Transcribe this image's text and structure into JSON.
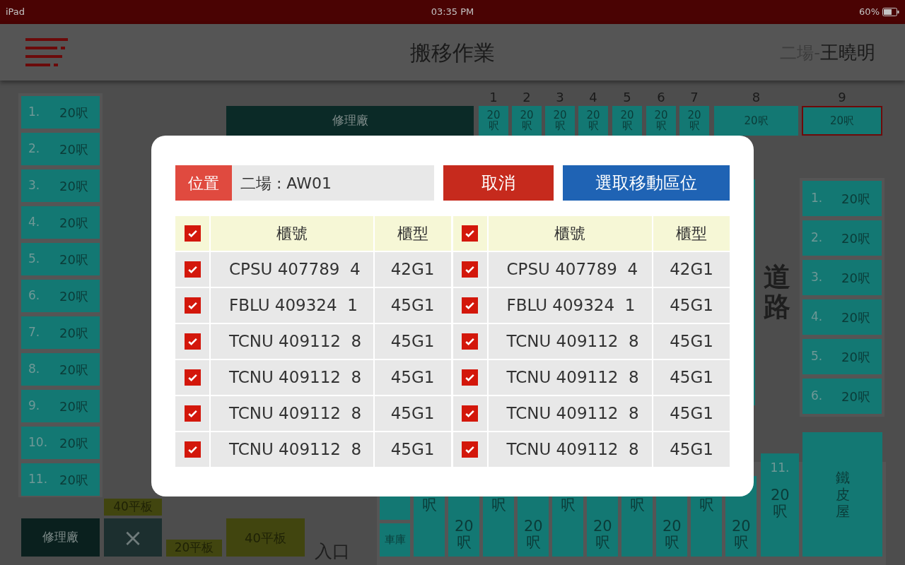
{
  "status_bar": {
    "device": "iPad",
    "time": "03:35 PM",
    "battery": "60%"
  },
  "header": {
    "title": "搬移作業",
    "site": "二場-",
    "user": "王曉明"
  },
  "top_area": {
    "workshop": "修理廠",
    "column_numbers": [
      "1",
      "2",
      "3",
      "4",
      "5",
      "6",
      "7",
      "8",
      "9"
    ],
    "slots": [
      {
        "label": "20呎",
        "kind": "narrow",
        "selected": false
      },
      {
        "label": "20呎",
        "kind": "narrow",
        "selected": false
      },
      {
        "label": "20呎",
        "kind": "narrow",
        "selected": false
      },
      {
        "label": "20呎",
        "kind": "narrow",
        "selected": false
      },
      {
        "label": "20呎",
        "kind": "narrow",
        "selected": false
      },
      {
        "label": "20呎",
        "kind": "narrow",
        "selected": false
      },
      {
        "label": "20呎",
        "kind": "narrow",
        "selected": false
      },
      {
        "label": "20呎",
        "kind": "wide",
        "selected": false
      },
      {
        "label": "20呎",
        "kind": "wide",
        "selected": true
      }
    ]
  },
  "left_slots": [
    {
      "number": "1.",
      "size": "20呎"
    },
    {
      "number": "2.",
      "size": "20呎"
    },
    {
      "number": "3.",
      "size": "20呎"
    },
    {
      "number": "4.",
      "size": "20呎"
    },
    {
      "number": "5.",
      "size": "20呎"
    },
    {
      "number": "6.",
      "size": "20呎"
    },
    {
      "number": "7.",
      "size": "20呎"
    },
    {
      "number": "8.",
      "size": "20呎"
    },
    {
      "number": "9.",
      "size": "20呎"
    },
    {
      "number": "10.",
      "size": "20呎"
    },
    {
      "number": "11.",
      "size": "20呎"
    }
  ],
  "bottom_left": {
    "flatbed_top": "40平板",
    "workshop": "修理廠",
    "closed_symbol": "×",
    "flatbed_small": "20平板",
    "flatbed_large": "40平板",
    "entrance": "入口"
  },
  "road": "道路",
  "right_slots": [
    {
      "number": "1.",
      "size": "20呎"
    },
    {
      "number": "2.",
      "size": "20呎"
    },
    {
      "number": "3.",
      "size": "20呎"
    },
    {
      "number": "4.",
      "size": "20呎"
    },
    {
      "number": "5.",
      "size": "20呎"
    },
    {
      "number": "6.",
      "size": "20呎"
    }
  ],
  "garage": "車庫",
  "bottom_slots": [
    {
      "label": "呎",
      "kind": "high"
    },
    {
      "label": "20呎",
      "kind": "low"
    },
    {
      "label": "呎",
      "kind": "high"
    },
    {
      "label": "20呎",
      "kind": "low"
    },
    {
      "label": "呎",
      "kind": "high"
    },
    {
      "label": "20呎",
      "kind": "low"
    },
    {
      "label": "呎",
      "kind": "high"
    },
    {
      "label": "20呎",
      "kind": "low"
    },
    {
      "label": "呎",
      "kind": "high"
    },
    {
      "label": "20呎",
      "kind": "low"
    }
  ],
  "corner_slot": {
    "number": "11.",
    "size": "20呎"
  },
  "tin_house": "鐵皮屋",
  "modal": {
    "location_label": "位置",
    "location_value": "二場 : AW01",
    "cancel": "取消",
    "confirm": "選取移動區位",
    "tables": [
      {
        "checked": true,
        "columns": [
          "櫃號",
          "櫃型"
        ],
        "rows": [
          {
            "checked": true,
            "container": "CPSU 407789  4",
            "type": "42G1"
          },
          {
            "checked": true,
            "container": "FBLU 409324  1",
            "type": "45G1"
          },
          {
            "checked": true,
            "container": "TCNU 409112  8",
            "type": "45G1"
          },
          {
            "checked": true,
            "container": "TCNU 409112  8",
            "type": "45G1"
          },
          {
            "checked": true,
            "container": "TCNU 409112  8",
            "type": "45G1"
          },
          {
            "checked": true,
            "container": "TCNU 409112  8",
            "type": "45G1"
          }
        ]
      },
      {
        "checked": true,
        "columns": [
          "櫃號",
          "櫃型"
        ],
        "rows": [
          {
            "checked": true,
            "container": "CPSU 407789  4",
            "type": "42G1"
          },
          {
            "checked": true,
            "container": "FBLU 409324  1",
            "type": "45G1"
          },
          {
            "checked": true,
            "container": "TCNU 409112  8",
            "type": "45G1"
          },
          {
            "checked": true,
            "container": "TCNU 409112  8",
            "type": "45G1"
          },
          {
            "checked": true,
            "container": "TCNU 409112  8",
            "type": "45G1"
          },
          {
            "checked": true,
            "container": "TCNU 409112  8",
            "type": "45G1"
          }
        ]
      }
    ]
  }
}
